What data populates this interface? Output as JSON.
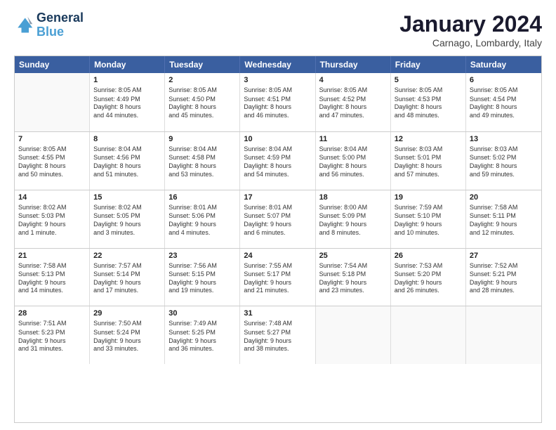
{
  "logo": {
    "line1": "General",
    "line2": "Blue"
  },
  "title": "January 2024",
  "subtitle": "Carnago, Lombardy, Italy",
  "header": {
    "days": [
      "Sunday",
      "Monday",
      "Tuesday",
      "Wednesday",
      "Thursday",
      "Friday",
      "Saturday"
    ]
  },
  "weeks": [
    [
      {
        "day": "",
        "sunrise": "",
        "sunset": "",
        "daylight": ""
      },
      {
        "day": "1",
        "sunrise": "Sunrise: 8:05 AM",
        "sunset": "Sunset: 4:49 PM",
        "daylight1": "Daylight: 8 hours",
        "daylight2": "and 44 minutes."
      },
      {
        "day": "2",
        "sunrise": "Sunrise: 8:05 AM",
        "sunset": "Sunset: 4:50 PM",
        "daylight1": "Daylight: 8 hours",
        "daylight2": "and 45 minutes."
      },
      {
        "day": "3",
        "sunrise": "Sunrise: 8:05 AM",
        "sunset": "Sunset: 4:51 PM",
        "daylight1": "Daylight: 8 hours",
        "daylight2": "and 46 minutes."
      },
      {
        "day": "4",
        "sunrise": "Sunrise: 8:05 AM",
        "sunset": "Sunset: 4:52 PM",
        "daylight1": "Daylight: 8 hours",
        "daylight2": "and 47 minutes."
      },
      {
        "day": "5",
        "sunrise": "Sunrise: 8:05 AM",
        "sunset": "Sunset: 4:53 PM",
        "daylight1": "Daylight: 8 hours",
        "daylight2": "and 48 minutes."
      },
      {
        "day": "6",
        "sunrise": "Sunrise: 8:05 AM",
        "sunset": "Sunset: 4:54 PM",
        "daylight1": "Daylight: 8 hours",
        "daylight2": "and 49 minutes."
      }
    ],
    [
      {
        "day": "7",
        "sunrise": "Sunrise: 8:05 AM",
        "sunset": "Sunset: 4:55 PM",
        "daylight1": "Daylight: 8 hours",
        "daylight2": "and 50 minutes."
      },
      {
        "day": "8",
        "sunrise": "Sunrise: 8:04 AM",
        "sunset": "Sunset: 4:56 PM",
        "daylight1": "Daylight: 8 hours",
        "daylight2": "and 51 minutes."
      },
      {
        "day": "9",
        "sunrise": "Sunrise: 8:04 AM",
        "sunset": "Sunset: 4:58 PM",
        "daylight1": "Daylight: 8 hours",
        "daylight2": "and 53 minutes."
      },
      {
        "day": "10",
        "sunrise": "Sunrise: 8:04 AM",
        "sunset": "Sunset: 4:59 PM",
        "daylight1": "Daylight: 8 hours",
        "daylight2": "and 54 minutes."
      },
      {
        "day": "11",
        "sunrise": "Sunrise: 8:04 AM",
        "sunset": "Sunset: 5:00 PM",
        "daylight1": "Daylight: 8 hours",
        "daylight2": "and 56 minutes."
      },
      {
        "day": "12",
        "sunrise": "Sunrise: 8:03 AM",
        "sunset": "Sunset: 5:01 PM",
        "daylight1": "Daylight: 8 hours",
        "daylight2": "and 57 minutes."
      },
      {
        "day": "13",
        "sunrise": "Sunrise: 8:03 AM",
        "sunset": "Sunset: 5:02 PM",
        "daylight1": "Daylight: 8 hours",
        "daylight2": "and 59 minutes."
      }
    ],
    [
      {
        "day": "14",
        "sunrise": "Sunrise: 8:02 AM",
        "sunset": "Sunset: 5:03 PM",
        "daylight1": "Daylight: 9 hours",
        "daylight2": "and 1 minute."
      },
      {
        "day": "15",
        "sunrise": "Sunrise: 8:02 AM",
        "sunset": "Sunset: 5:05 PM",
        "daylight1": "Daylight: 9 hours",
        "daylight2": "and 3 minutes."
      },
      {
        "day": "16",
        "sunrise": "Sunrise: 8:01 AM",
        "sunset": "Sunset: 5:06 PM",
        "daylight1": "Daylight: 9 hours",
        "daylight2": "and 4 minutes."
      },
      {
        "day": "17",
        "sunrise": "Sunrise: 8:01 AM",
        "sunset": "Sunset: 5:07 PM",
        "daylight1": "Daylight: 9 hours",
        "daylight2": "and 6 minutes."
      },
      {
        "day": "18",
        "sunrise": "Sunrise: 8:00 AM",
        "sunset": "Sunset: 5:09 PM",
        "daylight1": "Daylight: 9 hours",
        "daylight2": "and 8 minutes."
      },
      {
        "day": "19",
        "sunrise": "Sunrise: 7:59 AM",
        "sunset": "Sunset: 5:10 PM",
        "daylight1": "Daylight: 9 hours",
        "daylight2": "and 10 minutes."
      },
      {
        "day": "20",
        "sunrise": "Sunrise: 7:58 AM",
        "sunset": "Sunset: 5:11 PM",
        "daylight1": "Daylight: 9 hours",
        "daylight2": "and 12 minutes."
      }
    ],
    [
      {
        "day": "21",
        "sunrise": "Sunrise: 7:58 AM",
        "sunset": "Sunset: 5:13 PM",
        "daylight1": "Daylight: 9 hours",
        "daylight2": "and 14 minutes."
      },
      {
        "day": "22",
        "sunrise": "Sunrise: 7:57 AM",
        "sunset": "Sunset: 5:14 PM",
        "daylight1": "Daylight: 9 hours",
        "daylight2": "and 17 minutes."
      },
      {
        "day": "23",
        "sunrise": "Sunrise: 7:56 AM",
        "sunset": "Sunset: 5:15 PM",
        "daylight1": "Daylight: 9 hours",
        "daylight2": "and 19 minutes."
      },
      {
        "day": "24",
        "sunrise": "Sunrise: 7:55 AM",
        "sunset": "Sunset: 5:17 PM",
        "daylight1": "Daylight: 9 hours",
        "daylight2": "and 21 minutes."
      },
      {
        "day": "25",
        "sunrise": "Sunrise: 7:54 AM",
        "sunset": "Sunset: 5:18 PM",
        "daylight1": "Daylight: 9 hours",
        "daylight2": "and 23 minutes."
      },
      {
        "day": "26",
        "sunrise": "Sunrise: 7:53 AM",
        "sunset": "Sunset: 5:20 PM",
        "daylight1": "Daylight: 9 hours",
        "daylight2": "and 26 minutes."
      },
      {
        "day": "27",
        "sunrise": "Sunrise: 7:52 AM",
        "sunset": "Sunset: 5:21 PM",
        "daylight1": "Daylight: 9 hours",
        "daylight2": "and 28 minutes."
      }
    ],
    [
      {
        "day": "28",
        "sunrise": "Sunrise: 7:51 AM",
        "sunset": "Sunset: 5:23 PM",
        "daylight1": "Daylight: 9 hours",
        "daylight2": "and 31 minutes."
      },
      {
        "day": "29",
        "sunrise": "Sunrise: 7:50 AM",
        "sunset": "Sunset: 5:24 PM",
        "daylight1": "Daylight: 9 hours",
        "daylight2": "and 33 minutes."
      },
      {
        "day": "30",
        "sunrise": "Sunrise: 7:49 AM",
        "sunset": "Sunset: 5:25 PM",
        "daylight1": "Daylight: 9 hours",
        "daylight2": "and 36 minutes."
      },
      {
        "day": "31",
        "sunrise": "Sunrise: 7:48 AM",
        "sunset": "Sunset: 5:27 PM",
        "daylight1": "Daylight: 9 hours",
        "daylight2": "and 38 minutes."
      },
      {
        "day": "",
        "sunrise": "",
        "sunset": "",
        "daylight1": "",
        "daylight2": ""
      },
      {
        "day": "",
        "sunrise": "",
        "sunset": "",
        "daylight1": "",
        "daylight2": ""
      },
      {
        "day": "",
        "sunrise": "",
        "sunset": "",
        "daylight1": "",
        "daylight2": ""
      }
    ]
  ]
}
